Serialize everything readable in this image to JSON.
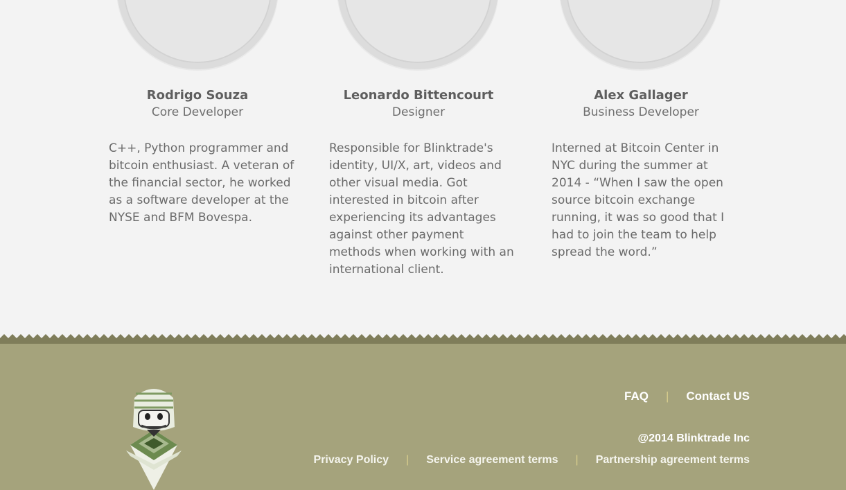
{
  "team": [
    {
      "name": "Rodrigo Souza",
      "role": "Core Developer",
      "bio": "C++, Python programmer and bitcoin enthusiast. A veteran of the financial sector, he worked as a software developer at the NYSE and BFM Bovespa."
    },
    {
      "name": "Leonardo Bittencourt",
      "role": "Designer",
      "bio": "Responsible for Blinktrade's identity, UI/X, art, videos and other visual media. Got interested in bitcoin after experiencing its advantages against other payment methods when working with an international client."
    },
    {
      "name": "Alex Gallager",
      "role": "Business Developer",
      "bio": "Interned at Bitcoin Center in NYC during the summer at 2014 - “When I saw the open source bitcoin exchange running, it was so good that I had to join the team to help spread the word.”"
    }
  ],
  "footer": {
    "faq": "FAQ",
    "contact": "Contact US",
    "separator": "|",
    "copyright": "@2014 Blinktrade Inc",
    "privacy": "Privacy Policy",
    "service_terms": "Service agreement terms",
    "partnership_terms": "Partnership agreement terms"
  },
  "colors": {
    "page_bg": "#f3f3f3",
    "footer_bg": "#a5a37c",
    "separator": "#d9cf8e",
    "link": "#ffffff"
  },
  "icons": {
    "mascot": "mascot-logo-icon"
  }
}
